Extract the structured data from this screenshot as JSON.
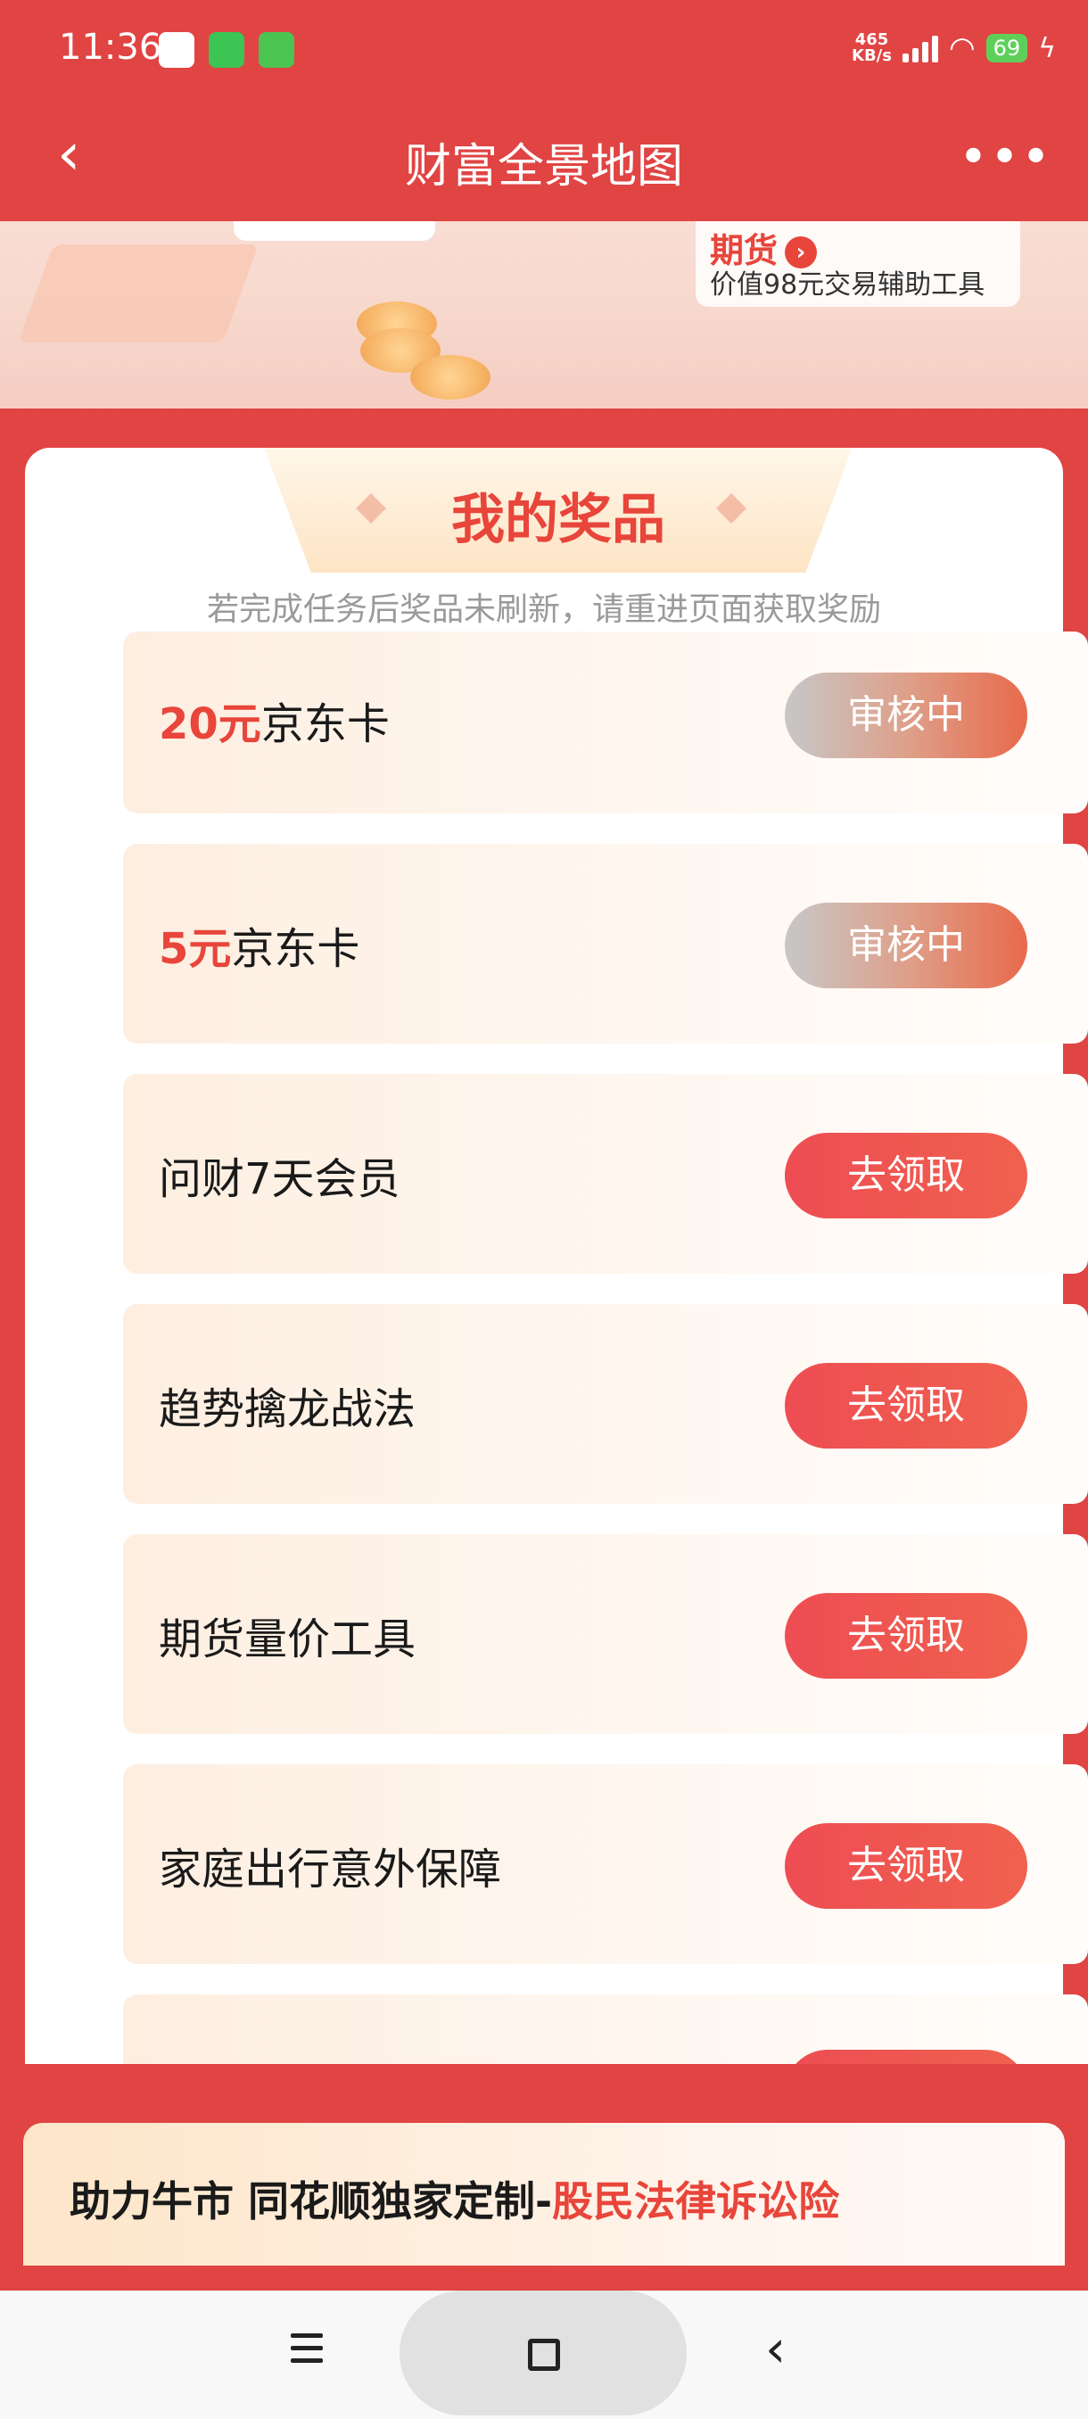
{
  "status": {
    "time": "11:36",
    "netspeed_value": "465",
    "netspeed_unit": "KB/s",
    "battery": "69"
  },
  "nav": {
    "back": "‹",
    "title": "财富全景地图",
    "more": "•••"
  },
  "banner": {
    "tag_title": "期货",
    "tag_arrow": "›",
    "tag_sub": "价值98元交易辅助工具"
  },
  "prizes": {
    "title": "我的奖品",
    "hint": "若完成任务后奖品未刷新，请重进页面获取奖励",
    "items": [
      {
        "highlight": "20元",
        "label": "京东卡",
        "button": "审核中"
      },
      {
        "highlight": "5元",
        "label": "京东卡",
        "button": "审核中"
      },
      {
        "highlight": "",
        "label": "问财7天会员",
        "button": "去领取"
      },
      {
        "highlight": "",
        "label": "趋势擒龙战法",
        "button": "去领取"
      },
      {
        "highlight": "",
        "label": "期货量价工具",
        "button": "去领取"
      },
      {
        "highlight": "",
        "label": "家庭出行意外保障",
        "button": "去领取"
      }
    ]
  },
  "promo": {
    "text_main": "助力牛市 同花顺独家定制-",
    "text_red": "股民法律诉讼险"
  },
  "sysnav": {
    "back": "‹"
  }
}
